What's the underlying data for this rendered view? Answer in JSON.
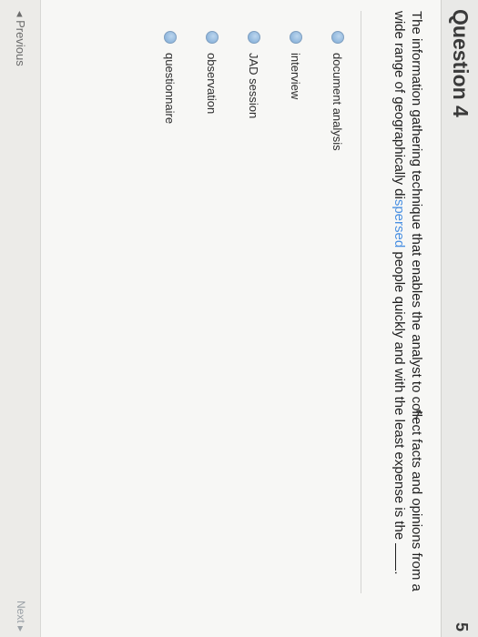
{
  "question": {
    "title": "Question 4",
    "points_fragment": "5",
    "text_part1": "The information gathering technique that enables the analyst to collect facts and opinions from a wide range of geographically di",
    "text_highlight": "spersed",
    "text_part2": " people quickly and with the least expense is the ",
    "text_end": "."
  },
  "choices": [
    {
      "label": "document analysis"
    },
    {
      "label": "interview"
    },
    {
      "label": "JAD session"
    },
    {
      "label": "observation"
    },
    {
      "label": "questionnaire"
    }
  ],
  "nav": {
    "previous": "◂ Previous",
    "next": "Next ▸"
  }
}
